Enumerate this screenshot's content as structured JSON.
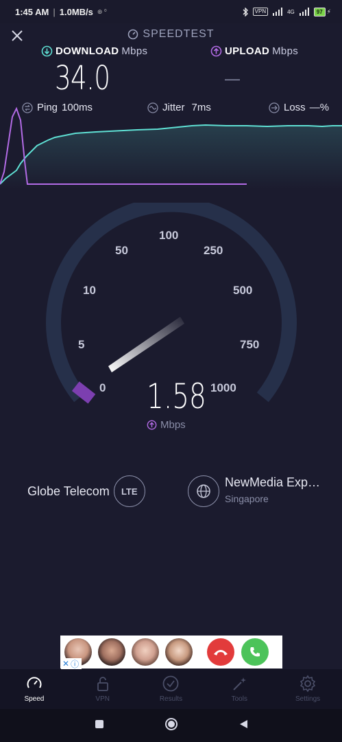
{
  "status_bar": {
    "time": "1:45 AM",
    "net_speed": "1.0MB/s",
    "vpn": "VPN",
    "network": "4G",
    "battery": "97"
  },
  "header": {
    "title": "SPEEDTEST"
  },
  "download": {
    "label": "DOWNLOAD",
    "unit": "Mbps",
    "value": "34.0"
  },
  "upload": {
    "label": "UPLOAD",
    "unit": "Mbps",
    "value": "—"
  },
  "stats": {
    "ping_label": "Ping",
    "ping_value": "100ms",
    "jitter_label": "Jitter",
    "jitter_value": "7ms",
    "loss_label": "Loss",
    "loss_value": "—%"
  },
  "gauge": {
    "ticks": [
      "0",
      "5",
      "10",
      "50",
      "100",
      "250",
      "500",
      "750",
      "1000"
    ],
    "current_value": "1.58",
    "unit": "Mbps"
  },
  "connection": {
    "provider": "Globe Telecom",
    "tech": "LTE",
    "server_name": "NewMedia Exp…",
    "server_location": "Singapore"
  },
  "tabs": [
    {
      "label": "Speed",
      "icon": "speedometer-icon",
      "active": true
    },
    {
      "label": "VPN",
      "icon": "lock-icon",
      "active": false
    },
    {
      "label": "Results",
      "icon": "check-circle-icon",
      "active": false
    },
    {
      "label": "Tools",
      "icon": "magic-wand-icon",
      "active": false
    },
    {
      "label": "Settings",
      "icon": "gear-icon",
      "active": false
    }
  ],
  "colors": {
    "background": "#1b1b2e",
    "download_accent": "#5fe0d4",
    "upload_accent": "#b36be6",
    "gauge_track": "#26304a"
  }
}
